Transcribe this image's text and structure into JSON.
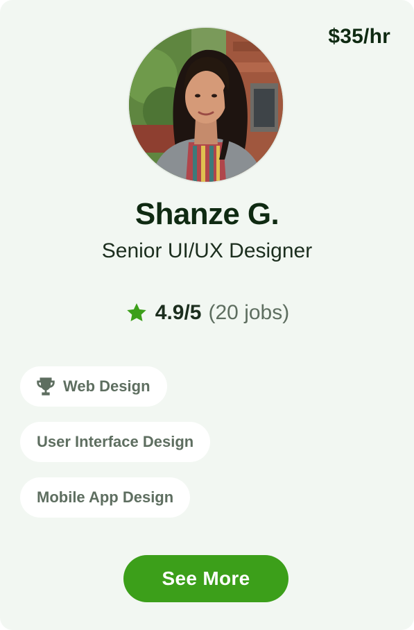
{
  "profile": {
    "rate": "$35/hr",
    "name": "Shanze G.",
    "title": "Senior UI/UX Designer",
    "avatar_icon": "profile-photo"
  },
  "rating": {
    "star_icon": "star-icon",
    "score": "4.9/5",
    "jobs": "(20 jobs)"
  },
  "skills": [
    {
      "label": "Web Design",
      "icon": "trophy-icon"
    },
    {
      "label": "User Interface Design"
    },
    {
      "label": "Mobile App Design"
    }
  ],
  "actions": {
    "see_more_label": "See More"
  },
  "colors": {
    "card_bg": "#f2f7f2",
    "accent": "#3c9f1a",
    "text_dark": "#0f2a12",
    "text_muted": "#5e6e60",
    "chip_bg": "#ffffff"
  }
}
